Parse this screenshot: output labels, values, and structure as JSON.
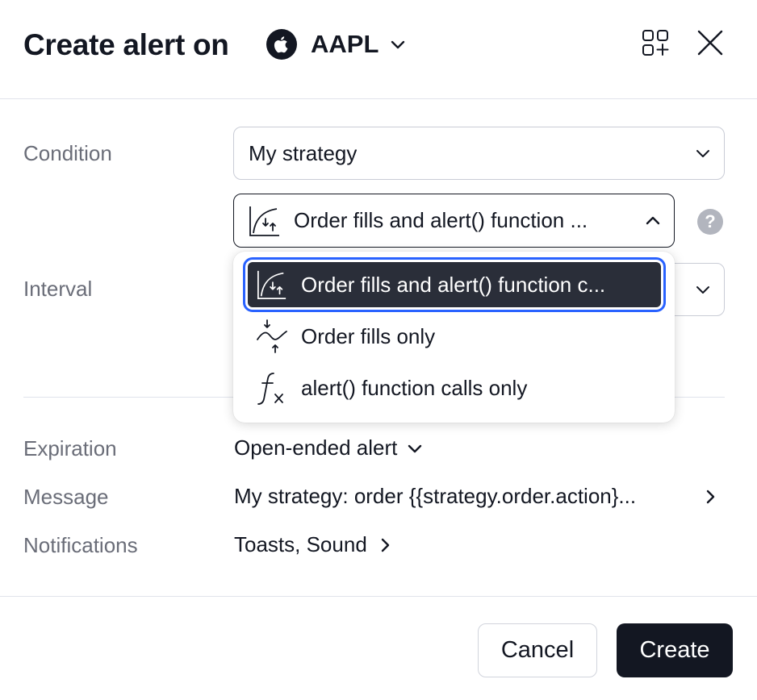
{
  "header": {
    "title": "Create alert on",
    "symbol": "AAPL",
    "icons": {
      "logo": "apple-logo-icon",
      "add_symbol": "grid-plus-icon",
      "close": "close-icon",
      "symbol_chevron": "chevron-down-icon"
    }
  },
  "form": {
    "condition_label": "Condition",
    "condition_value": "My strategy",
    "alert_type_value": "Order fills and alert() function ...",
    "help": "?",
    "interval_label": "Interval",
    "interval_value": "",
    "expiration_label": "Expiration",
    "expiration_value": "Open-ended alert",
    "message_label": "Message",
    "message_value": "My strategy: order {{strategy.order.action}...",
    "notifications_label": "Notifications",
    "notifications_value": "Toasts, Sound"
  },
  "dropdown": {
    "options": [
      {
        "label": "Order fills and alert() function c...",
        "icon": "order-fills-curve-icon",
        "selected": true
      },
      {
        "label": "Order fills only",
        "icon": "order-fills-zigzag-icon",
        "selected": false
      },
      {
        "label": "alert() function calls only",
        "icon": "function-fx-icon",
        "selected": false
      }
    ]
  },
  "footer": {
    "cancel_label": "Cancel",
    "create_label": "Create"
  },
  "colors": {
    "text": "#131722",
    "muted": "#6a6d78",
    "border": "#c9ccd6",
    "selected_bg": "#2a2e39",
    "focus": "#2962ff",
    "primary_button": "#131722"
  }
}
